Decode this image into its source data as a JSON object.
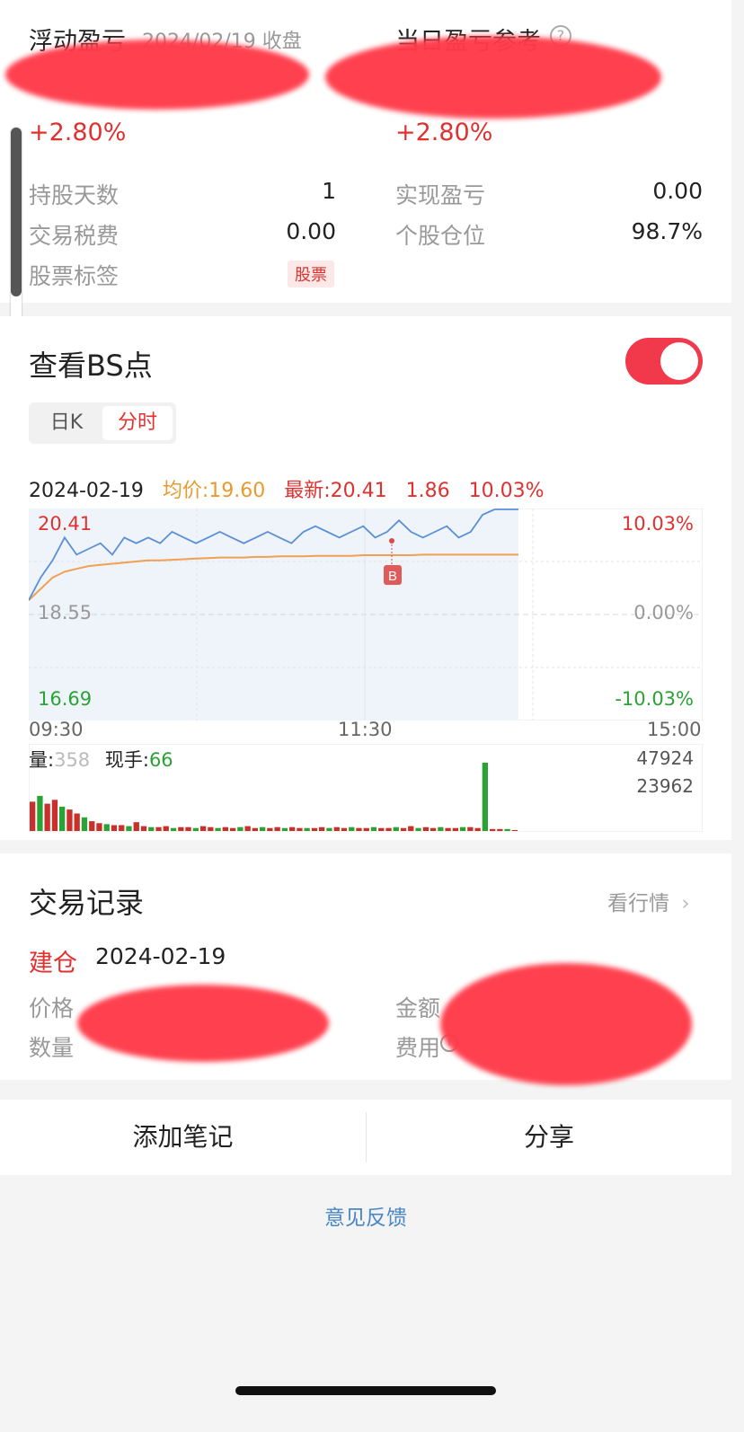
{
  "summary": {
    "float_pl_label": "浮动盈亏",
    "float_pl_date": "2024/02/19 收盘",
    "float_pl_pct": "+2.80%",
    "day_pl_label": "当日盈亏参考",
    "day_pl_pct": "+2.80%",
    "rows": [
      {
        "label": "持股天数",
        "value": "1"
      },
      {
        "label": "实现盈亏",
        "value": "0.00"
      },
      {
        "label": "交易税费",
        "value": "0.00"
      },
      {
        "label": "个股仓位",
        "value": "98.7%"
      },
      {
        "label": "股票标签",
        "value": ""
      }
    ],
    "tag": "股票"
  },
  "bs": {
    "title": "查看BS点",
    "toggle_on": true,
    "tabs": [
      "日K",
      "分时"
    ],
    "active_tab": "分时"
  },
  "chart_header": {
    "date": "2024-02-19",
    "avg": "均价:19.60",
    "latest": "最新:20.41",
    "change": "1.86",
    "change_pct": "10.03%"
  },
  "chart_labels": {
    "price_high": "20.41",
    "price_mid": "18.55",
    "price_low": "16.69",
    "pct_high": "10.03%",
    "pct_mid": "0.00%",
    "pct_low": "-10.03%",
    "t_start": "09:30",
    "t_mid": "11:30",
    "t_end": "15:00",
    "marker": "B",
    "vol_label": "量:",
    "vol_value": "358",
    "hand_label": "现手:",
    "hand_value": "66",
    "vol_max": "47924",
    "vol_half": "23962"
  },
  "chart_data": {
    "type": "line",
    "x_range": [
      "09:30",
      "15:00"
    ],
    "ylim": [
      16.69,
      20.41
    ],
    "series": [
      {
        "values": [
          18.8,
          19.2,
          19.5,
          19.9,
          19.6,
          19.7,
          19.8,
          19.6,
          19.9,
          19.8,
          19.9,
          19.8,
          20.0,
          19.9,
          19.8,
          19.9,
          20.0,
          19.9,
          19.8,
          19.9,
          20.0,
          19.9,
          19.8,
          20.0,
          20.1,
          20.0,
          19.9,
          20.0,
          20.1,
          19.9,
          20.0,
          20.2,
          20.0,
          19.9,
          20.0,
          20.1,
          19.9,
          20.0,
          20.3,
          20.4,
          20.41,
          20.41
        ]
      },
      {
        "values": [
          18.8,
          19.0,
          19.2,
          19.3,
          19.35,
          19.4,
          19.42,
          19.44,
          19.46,
          19.48,
          19.5,
          19.5,
          19.51,
          19.52,
          19.53,
          19.54,
          19.55,
          19.55,
          19.55,
          19.56,
          19.56,
          19.57,
          19.57,
          19.57,
          19.58,
          19.58,
          19.58,
          19.58,
          19.59,
          19.59,
          19.59,
          19.59,
          19.59,
          19.6,
          19.6,
          19.6,
          19.6,
          19.6,
          19.6,
          19.6,
          19.6,
          19.6
        ]
      }
    ],
    "volume": [
      30,
      36,
      28,
      32,
      25,
      22,
      18,
      14,
      10,
      8,
      7,
      6,
      6,
      5,
      9,
      5,
      4,
      4,
      5,
      3,
      4,
      4,
      3,
      5,
      4,
      3,
      4,
      3,
      4,
      5,
      3,
      4,
      3,
      4,
      3,
      4,
      3,
      3,
      3,
      4,
      3,
      4,
      3,
      4,
      3,
      3,
      4,
      3,
      3,
      4,
      3,
      5,
      3,
      4,
      3,
      4,
      3,
      3,
      4,
      4,
      3,
      70,
      2,
      2,
      2,
      1
    ]
  },
  "trade": {
    "title": "交易记录",
    "more": "看行情",
    "action": "建仓",
    "date": "2024-02-19",
    "price_label": "价格",
    "amount_label": "金额",
    "qty_label": "数量",
    "fee_label": "费用"
  },
  "actions": {
    "note": "添加笔记",
    "share": "分享"
  },
  "feedback": "意见反馈"
}
